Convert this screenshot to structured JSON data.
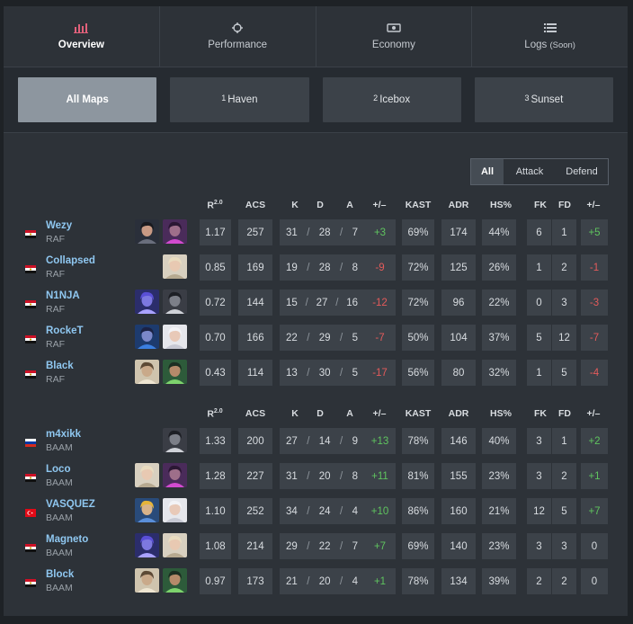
{
  "tabs": [
    {
      "label": "Overview",
      "icon": "bar-chart-icon",
      "active": true
    },
    {
      "label": "Performance",
      "icon": "crosshair-icon",
      "active": false
    },
    {
      "label": "Economy",
      "icon": "cash-icon",
      "active": false
    },
    {
      "label": "Logs",
      "note": "(Soon)",
      "icon": "list-icon",
      "active": false
    }
  ],
  "maps": [
    {
      "num": "",
      "label": "All Maps",
      "active": true
    },
    {
      "num": "1",
      "label": "Haven",
      "active": false
    },
    {
      "num": "2",
      "label": "Icebox",
      "active": false
    },
    {
      "num": "3",
      "label": "Sunset",
      "active": false
    }
  ],
  "side_filter": {
    "all": "All",
    "attack": "Attack",
    "defend": "Defend"
  },
  "columns": {
    "rating": "R",
    "rating_sup": "2.0",
    "acs": "ACS",
    "k": "K",
    "d": "D",
    "a": "A",
    "pm": "+/–",
    "kast": "KAST",
    "adr": "ADR",
    "hs": "HS%",
    "fk": "FK",
    "fd": "FD",
    "fkpm": "+/–"
  },
  "colors": {
    "positive": "#5fc45f",
    "negative": "#e35b5b",
    "name": "#8fc7f0"
  },
  "teams": [
    {
      "players": [
        {
          "name": "Wezy",
          "team": "RAF",
          "flag": "egypt",
          "agents": [
            "agent-dark",
            "agent-purple"
          ],
          "rating": "1.17",
          "acs": "257",
          "k": "31",
          "d": "28",
          "a": "7",
          "pm": "+3",
          "kast": "69%",
          "adr": "174",
          "hs": "44%",
          "fk": "6",
          "fd": "1",
          "fkpm": "+5"
        },
        {
          "name": "Collapsed",
          "team": "RAF",
          "flag": "egypt",
          "agents": [
            "agent-blonde"
          ],
          "rating": "0.85",
          "acs": "169",
          "k": "19",
          "d": "28",
          "a": "8",
          "pm": "-9",
          "kast": "72%",
          "adr": "125",
          "hs": "26%",
          "fk": "1",
          "fd": "2",
          "fkpm": "-1"
        },
        {
          "name": "N1NJA",
          "team": "RAF",
          "flag": "egypt",
          "agents": [
            "agent-violet",
            "agent-masked"
          ],
          "rating": "0.72",
          "acs": "144",
          "k": "15",
          "d": "27",
          "a": "16",
          "pm": "-12",
          "kast": "72%",
          "adr": "96",
          "hs": "22%",
          "fk": "0",
          "fd": "3",
          "fkpm": "-3"
        },
        {
          "name": "RockeT",
          "team": "RAF",
          "flag": "egypt",
          "agents": [
            "agent-blue",
            "agent-white"
          ],
          "rating": "0.70",
          "acs": "166",
          "k": "22",
          "d": "29",
          "a": "5",
          "pm": "-7",
          "kast": "50%",
          "adr": "104",
          "hs": "37%",
          "fk": "5",
          "fd": "12",
          "fkpm": "-7"
        },
        {
          "name": "Black",
          "team": "RAF",
          "flag": "egypt",
          "agents": [
            "agent-hat",
            "agent-green"
          ],
          "rating": "0.43",
          "acs": "114",
          "k": "13",
          "d": "30",
          "a": "5",
          "pm": "-17",
          "kast": "56%",
          "adr": "80",
          "hs": "32%",
          "fk": "1",
          "fd": "5",
          "fkpm": "-4"
        }
      ]
    },
    {
      "players": [
        {
          "name": "m4xikk",
          "team": "BAAM",
          "flag": "russia",
          "agents": [
            "agent-masked"
          ],
          "rating": "1.33",
          "acs": "200",
          "k": "27",
          "d": "14",
          "a": "9",
          "pm": "+13",
          "kast": "78%",
          "adr": "146",
          "hs": "40%",
          "fk": "3",
          "fd": "1",
          "fkpm": "+2"
        },
        {
          "name": "Loco",
          "team": "BAAM",
          "flag": "egypt",
          "agents": [
            "agent-blonde",
            "agent-purple"
          ],
          "rating": "1.28",
          "acs": "227",
          "k": "31",
          "d": "20",
          "a": "8",
          "pm": "+11",
          "kast": "81%",
          "adr": "155",
          "hs": "23%",
          "fk": "3",
          "fd": "2",
          "fkpm": "+1"
        },
        {
          "name": "VASQUEZ",
          "team": "BAAM",
          "flag": "turkey",
          "agents": [
            "agent-gold",
            "agent-white"
          ],
          "rating": "1.10",
          "acs": "252",
          "k": "34",
          "d": "24",
          "a": "4",
          "pm": "+10",
          "kast": "86%",
          "adr": "160",
          "hs": "21%",
          "fk": "12",
          "fd": "5",
          "fkpm": "+7"
        },
        {
          "name": "Magneto",
          "team": "BAAM",
          "flag": "egypt",
          "agents": [
            "agent-violet",
            "agent-blonde"
          ],
          "rating": "1.08",
          "acs": "214",
          "k": "29",
          "d": "22",
          "a": "7",
          "pm": "+7",
          "kast": "69%",
          "adr": "140",
          "hs": "23%",
          "fk": "3",
          "fd": "3",
          "fkpm": "0"
        },
        {
          "name": "Block",
          "team": "BAAM",
          "flag": "egypt",
          "agents": [
            "agent-hat",
            "agent-green"
          ],
          "rating": "0.97",
          "acs": "173",
          "k": "21",
          "d": "20",
          "a": "4",
          "pm": "+1",
          "kast": "78%",
          "adr": "134",
          "hs": "39%",
          "fk": "2",
          "fd": "2",
          "fkpm": "0"
        }
      ]
    }
  ]
}
